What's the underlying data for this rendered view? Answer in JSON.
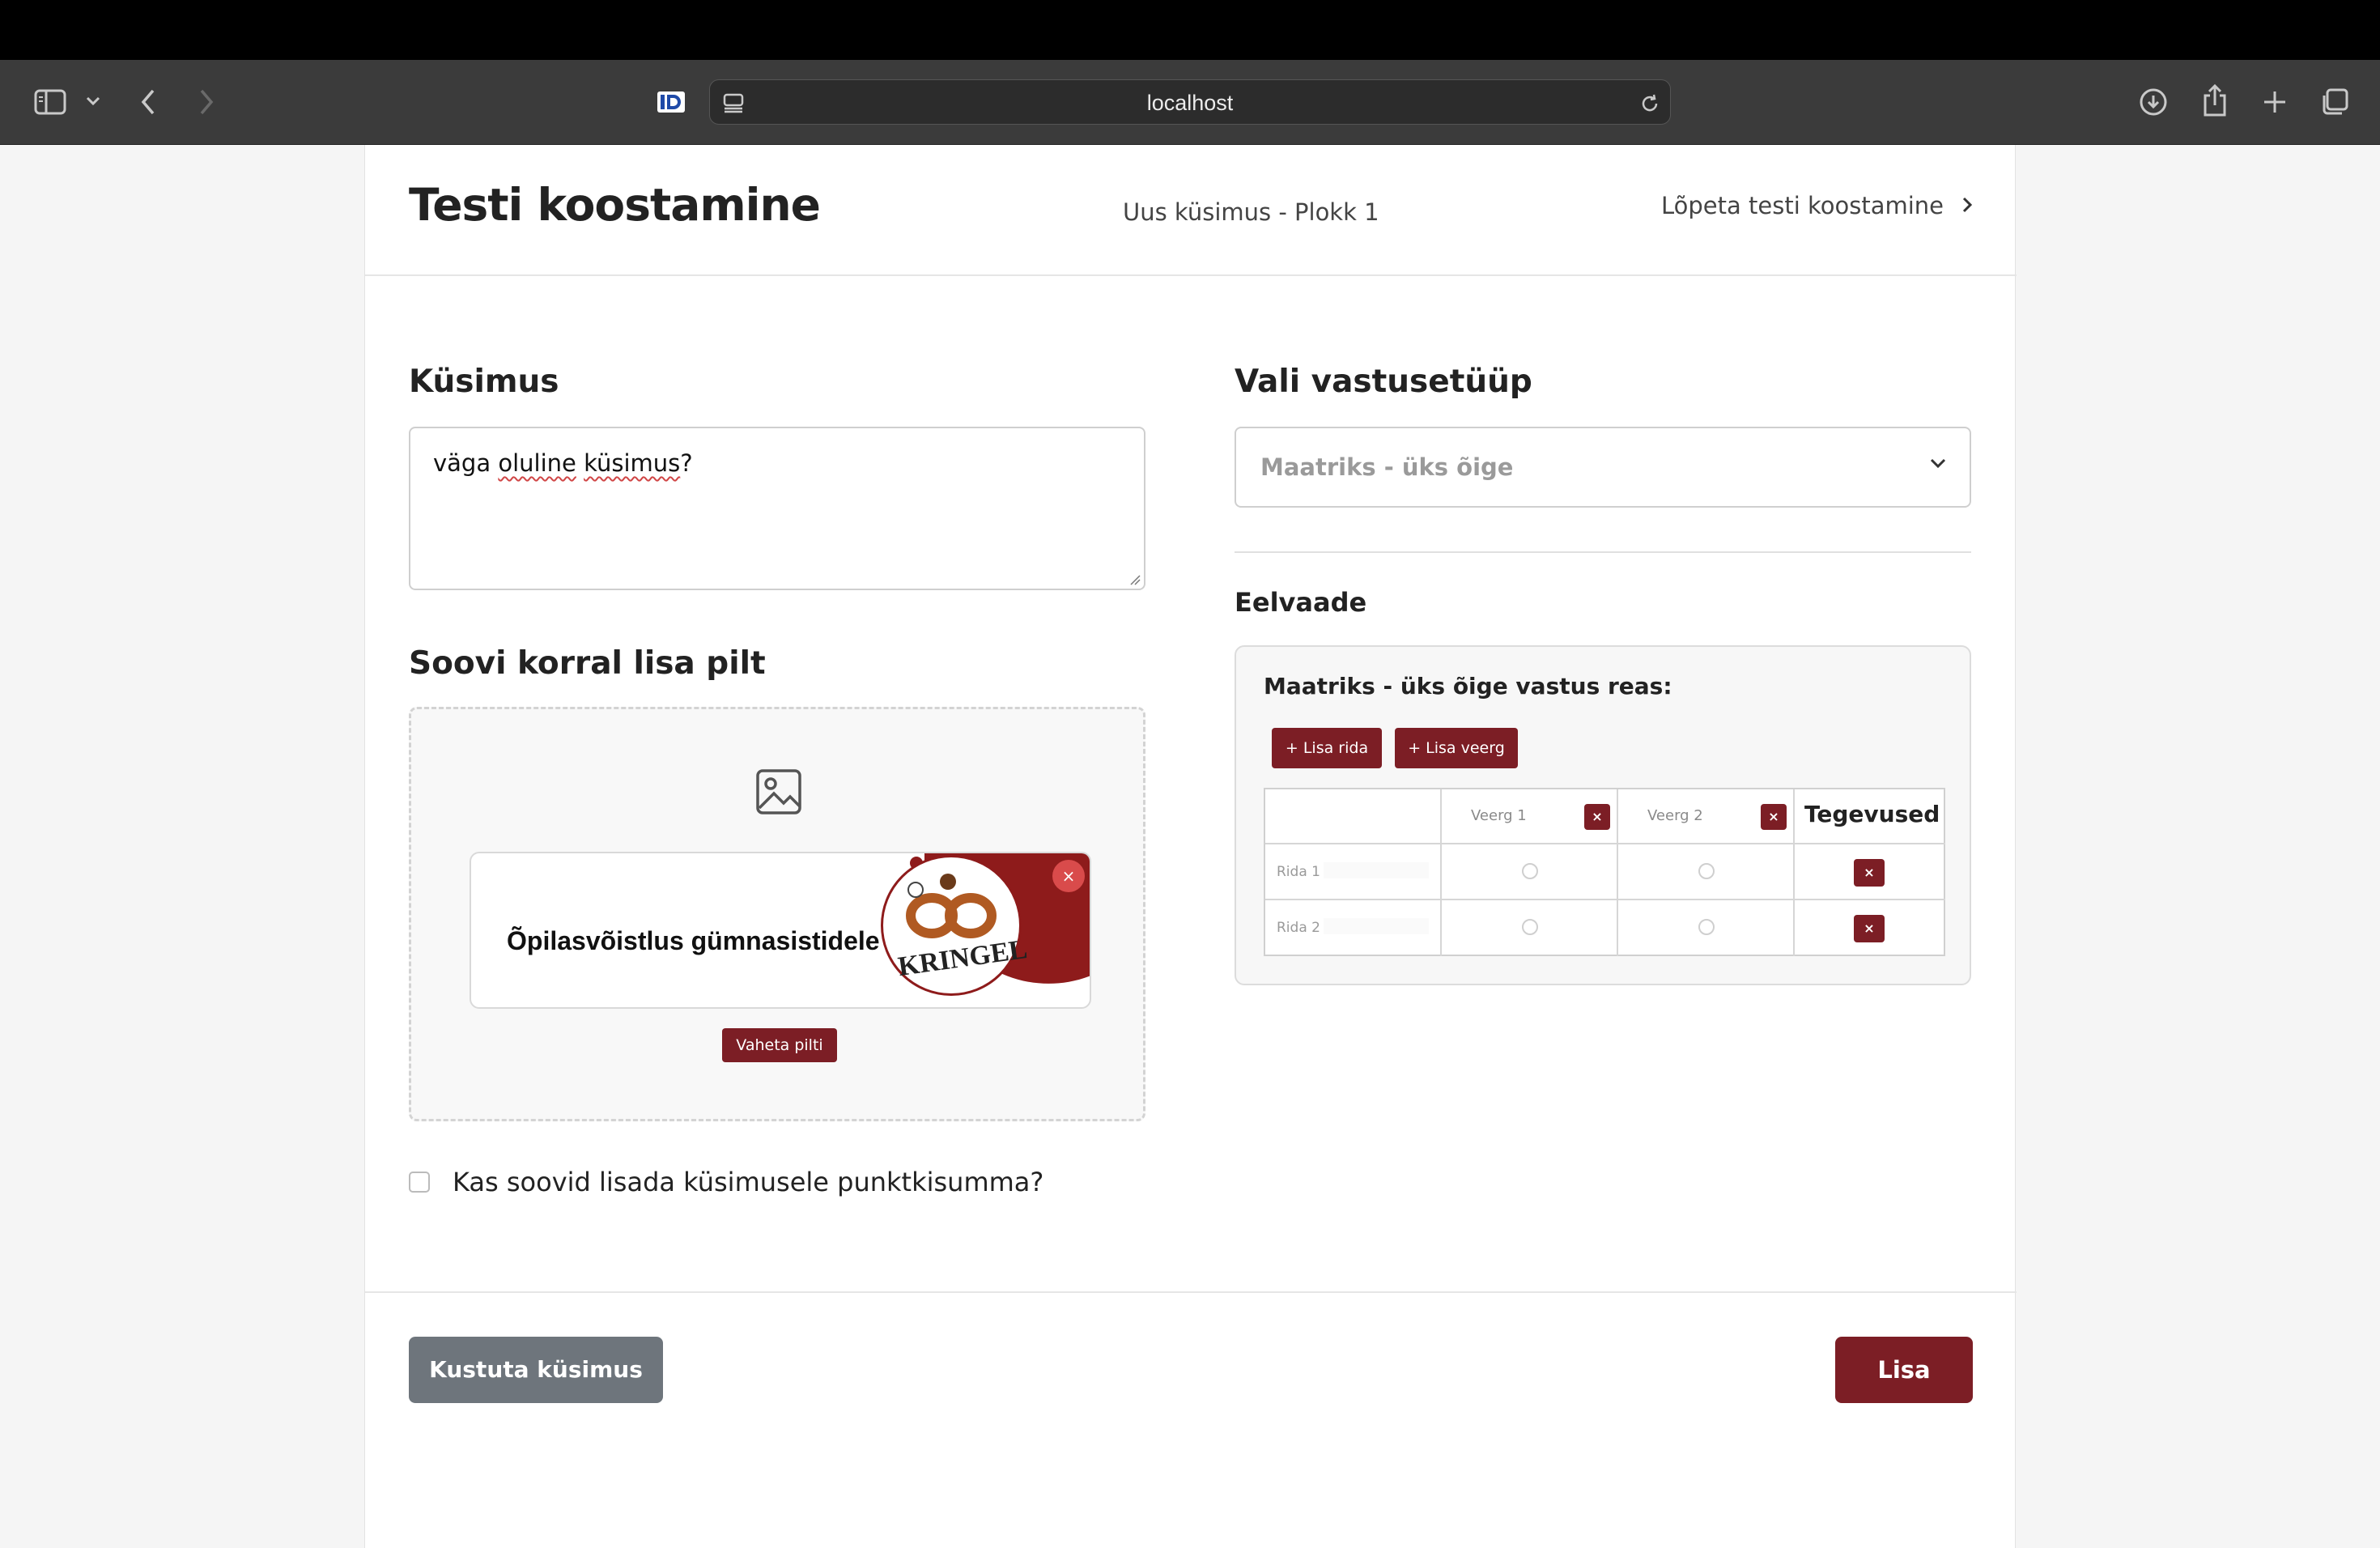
{
  "browser": {
    "url": "localhost"
  },
  "header": {
    "title": "Testi koostamine",
    "breadcrumb": "Uus küsimus - Plokk 1",
    "finish_label": "Lõpeta testi koostamine"
  },
  "question": {
    "heading": "Küsimus",
    "value_parts": [
      "väga ",
      "oluline",
      " ",
      "küsimus",
      "?"
    ]
  },
  "image": {
    "heading": "Soovi korral lisa pilt",
    "banner_text": "Õpilasvõistlus gümnasistidele",
    "logo_text": "KRINGEL",
    "swap_label": "Vaheta pilti",
    "close_symbol": "×"
  },
  "points_checkbox": {
    "label": "Kas soovid lisada küsimusele punktkisumma?",
    "checked": false
  },
  "answer_type": {
    "heading": "Vali vastusetüüp",
    "selected": "Maatriks - üks õige"
  },
  "preview": {
    "heading": "Eelvaade",
    "title": "Maatriks - üks õige vastus reas:",
    "add_row_label": "+ Lisa rida",
    "add_col_label": "+ Lisa veerg",
    "columns": [
      "Veerg 1",
      "Veerg 2"
    ],
    "actions_header": "Tegevused",
    "rows": [
      "Rida 1",
      "Rida 2"
    ],
    "delete_symbol": "×"
  },
  "footer": {
    "delete_label": "Kustuta küsimus",
    "add_label": "Lisa"
  },
  "colors": {
    "accent": "#7c1e25",
    "secondary": "#6e757c"
  }
}
